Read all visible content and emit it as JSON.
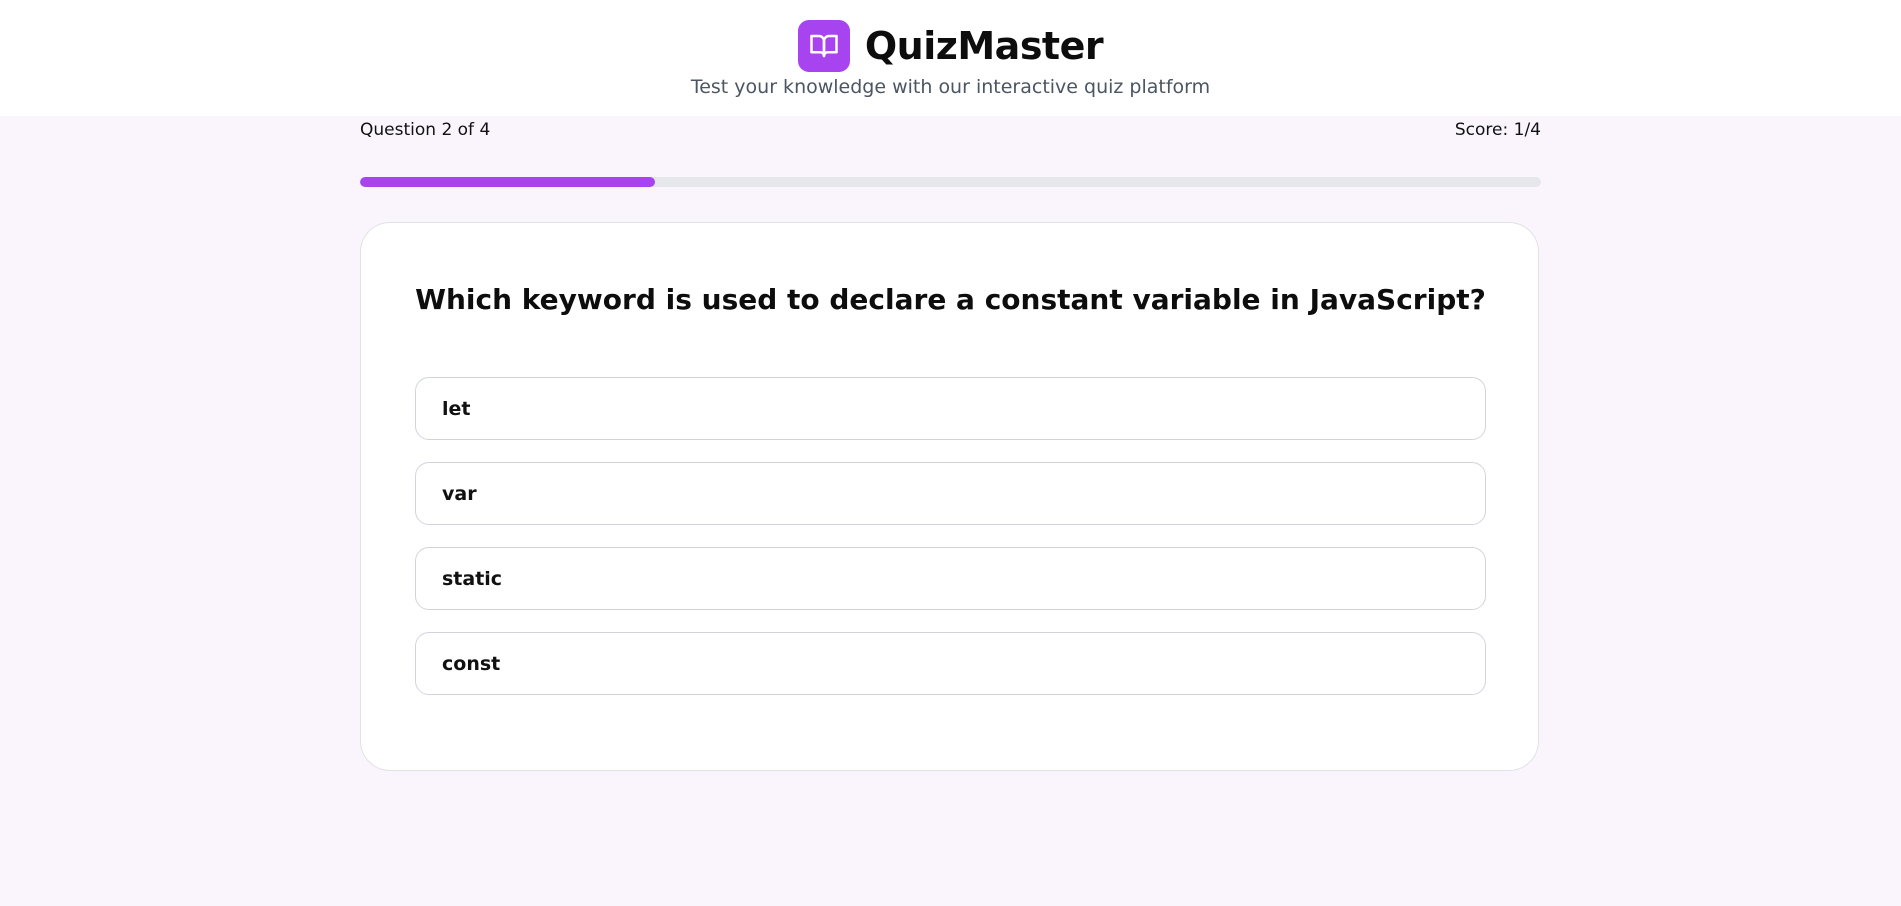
{
  "app": {
    "title": "QuizMaster",
    "tagline": "Test your knowledge with our interactive quiz platform",
    "logo_icon": "open-book-icon",
    "accent_color": "#a744f0"
  },
  "progress": {
    "question_label": "Question 2 of 4",
    "score_label": "Score: 1/4",
    "fraction": 0.25
  },
  "question": {
    "text": "Which keyword is used to declare a constant variable in JavaScript?",
    "options": [
      "let",
      "var",
      "static",
      "const"
    ]
  }
}
